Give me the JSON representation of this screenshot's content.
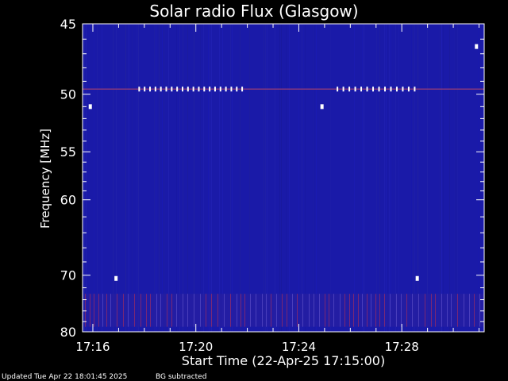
{
  "chart_data": {
    "type": "heatmap",
    "title": "Solar radio Flux (Glasgow)",
    "xlabel": "Start Time (22-Apr-25 17:15:00)",
    "ylabel": "Frequency [MHz]",
    "x_unit": "minutes after 17:15:00",
    "xlim": [
      0.6,
      16.2
    ],
    "ylim": [
      80,
      45
    ],
    "y_scale": "reciprocal",
    "x_ticks": [
      {
        "value": 1,
        "label": "17:16"
      },
      {
        "value": 5,
        "label": "17:20"
      },
      {
        "value": 9,
        "label": "17:24"
      },
      {
        "value": 13,
        "label": "17:28"
      }
    ],
    "y_ticks": [
      {
        "value": 45,
        "label": "45"
      },
      {
        "value": 50,
        "label": "50"
      },
      {
        "value": 55,
        "label": "55"
      },
      {
        "value": 60,
        "label": "60"
      },
      {
        "value": 70,
        "label": "70"
      },
      {
        "value": 80,
        "label": "80"
      }
    ],
    "colors": {
      "background": "#000000",
      "field": "#1a1aa8",
      "interference": "#ffffff",
      "bright_band": "#c03050",
      "axes": "#ffffff"
    },
    "interference_line_mhz": 49.6,
    "interference_pulses": [
      {
        "t_start": 2.8,
        "t_end": 6.8,
        "count": 20
      },
      {
        "t_start": 10.5,
        "t_end": 13.5,
        "count": 14
      }
    ],
    "bursts": [
      {
        "t": 0.9,
        "f_mhz": 51.0
      },
      {
        "t": 9.9,
        "f_mhz": 51.0
      },
      {
        "t": 1.9,
        "f_mhz": 70.5
      },
      {
        "t": 13.6,
        "f_mhz": 70.5
      },
      {
        "t": 15.9,
        "f_mhz": 46.5
      }
    ],
    "noisy_band_mhz": [
      73.0,
      79.0
    ]
  },
  "footer": {
    "status": "Updated Tue Apr 22 18:01:45 2025",
    "note": "BG subtracted"
  }
}
